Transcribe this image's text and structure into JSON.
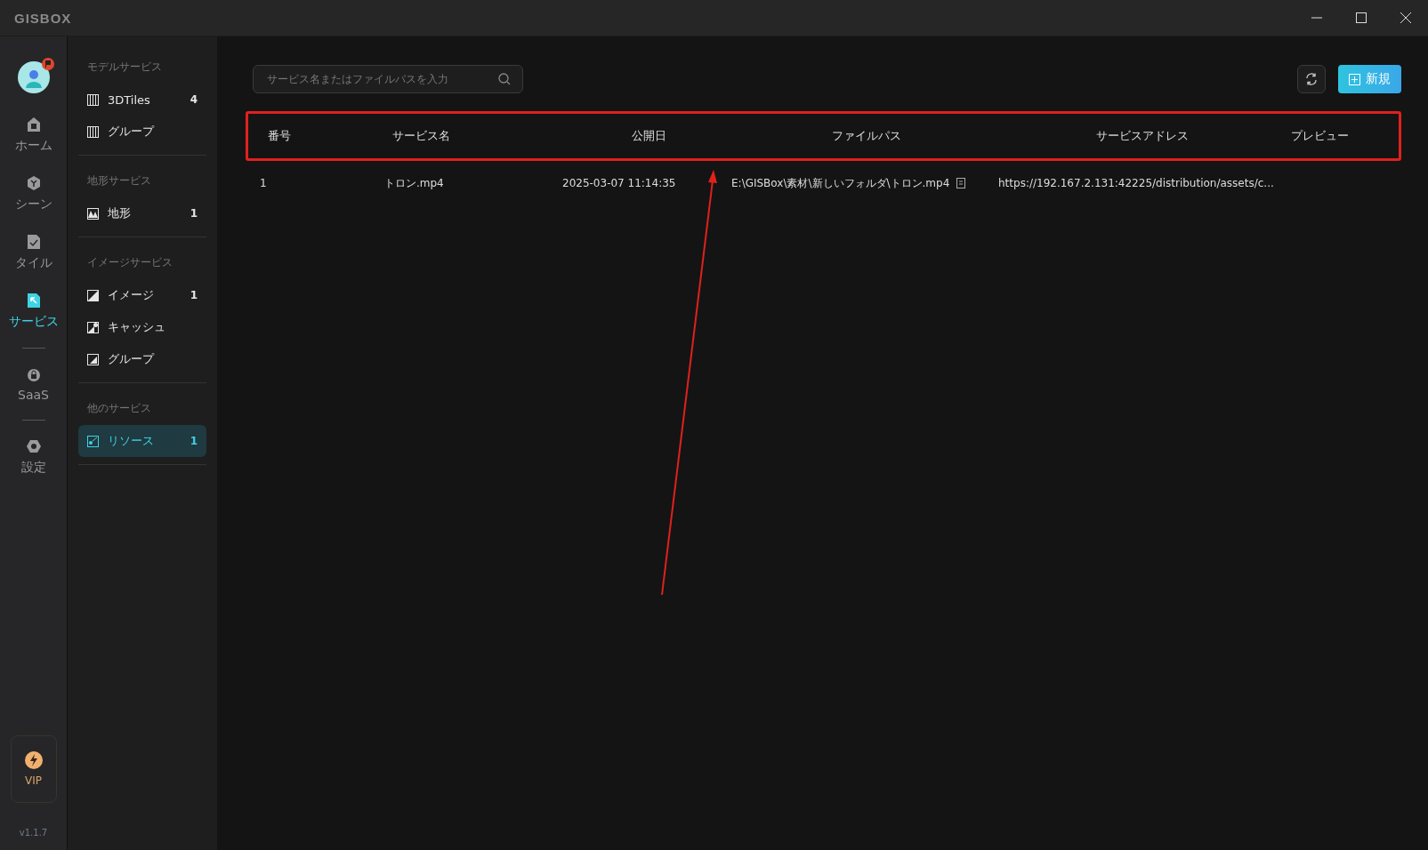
{
  "window": {
    "logo": "GISBOX"
  },
  "nav": {
    "items": [
      {
        "label": "ホーム",
        "kind": "home",
        "selected": false
      },
      {
        "label": "シーン",
        "kind": "scene",
        "selected": false
      },
      {
        "label": "タイル",
        "kind": "tile",
        "selected": false
      },
      {
        "label": "サービス",
        "kind": "service",
        "selected": true
      },
      {
        "label": "SaaS",
        "kind": "saas",
        "selected": false
      },
      {
        "label": "設定",
        "kind": "settings",
        "selected": false
      }
    ],
    "vip": "VIP",
    "version": "v1.1.7"
  },
  "sidebar": {
    "sections": [
      {
        "title": "モデルサービス",
        "items": [
          {
            "label": "3DTiles",
            "count": "4",
            "kind": "tiles",
            "selected": false
          },
          {
            "label": "グループ",
            "kind": "tiles",
            "selected": false
          }
        ]
      },
      {
        "title": "地形サービス",
        "items": [
          {
            "label": "地形",
            "count": "1",
            "kind": "terrain",
            "selected": false
          }
        ]
      },
      {
        "title": "イメージサービス",
        "items": [
          {
            "label": "イメージ",
            "count": "1",
            "kind": "image",
            "selected": false
          },
          {
            "label": "キャッシュ",
            "kind": "cache",
            "selected": false
          },
          {
            "label": "グループ",
            "kind": "group",
            "selected": false
          }
        ]
      },
      {
        "title": "他のサービス",
        "items": [
          {
            "label": "リソース",
            "count": "1",
            "kind": "resource",
            "selected": true
          }
        ]
      }
    ]
  },
  "toolbar": {
    "search": {
      "placeholder": "サービス名またはファイルパスを入力"
    },
    "new_button": "新規"
  },
  "table": {
    "columns": [
      "番号",
      "サービス名",
      "公開日",
      "ファイルパス",
      "サービスアドレス",
      "プレビュー"
    ],
    "rows": [
      {
        "cells": [
          "1",
          "トロン.mp4",
          "2025-03-07 11:14:35",
          "E:\\GISBox\\素材\\新しいフォルダ\\トロン.mp4",
          "https://192.167.2.131:42225/distribution/assets/c..."
        ]
      }
    ]
  }
}
